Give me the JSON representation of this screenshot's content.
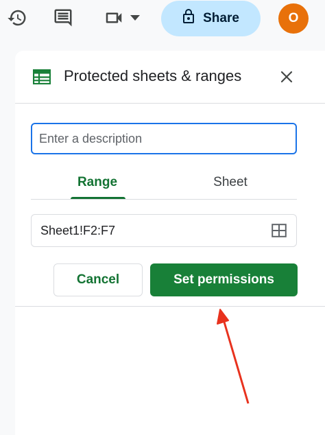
{
  "toolbar": {
    "icons": [
      "history-icon",
      "comment-icon",
      "video-call-icon",
      "dropdown-arrow-icon",
      "lock-icon"
    ],
    "share_label": "Share",
    "avatar_initial": "O"
  },
  "panel": {
    "title": "Protected sheets & ranges",
    "description": {
      "placeholder": "Enter a description",
      "value": ""
    },
    "tabs": [
      {
        "label": "Range",
        "active": true
      },
      {
        "label": "Sheet",
        "active": false
      }
    ],
    "range_value": "Sheet1!F2:F7",
    "cancel_label": "Cancel",
    "set_permissions_label": "Set permissions"
  },
  "colors": {
    "accent_green": "#188038",
    "share_bg": "#c2e7ff",
    "avatar_bg": "#e8710a",
    "focus_blue": "#1a73e8",
    "annotation_red": "#e8321e"
  }
}
